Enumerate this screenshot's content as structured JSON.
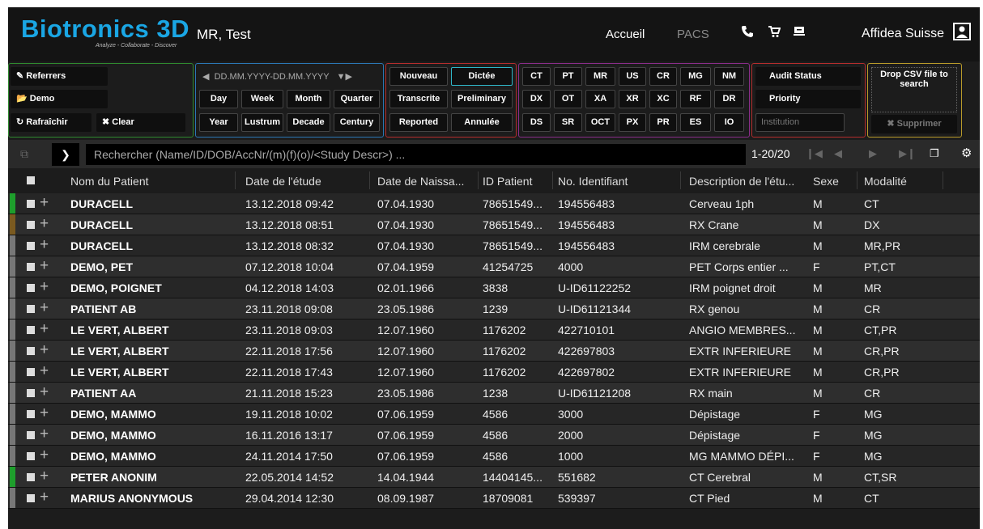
{
  "header": {
    "logo": "Biotronics 3D",
    "tagline": "Analyze - Collaborate - Discover",
    "user_name": "MR, Test",
    "nav_accueil": "Accueil",
    "nav_pacs": "PACS",
    "institution": "Affidea Suisse"
  },
  "filters": {
    "referrers": "Referrers",
    "demo": "Demo",
    "refresh": "Rafraîchir",
    "clear": "Clear",
    "date_placeholder": "DD.MM.YYYY-DD.MM.YYYY",
    "periods_row1": [
      "Day",
      "Week",
      "Month",
      "Quarter"
    ],
    "periods_row2": [
      "Year",
      "Lustrum",
      "Decade",
      "Century"
    ],
    "status": {
      "nouveau": "Nouveau",
      "dictee": "Dictée",
      "transcrite": "Transcrite",
      "preliminary": "Preliminary",
      "reported": "Reported",
      "annulee": "Annulée"
    },
    "modalities_row1": [
      "CT",
      "PT",
      "MR",
      "US",
      "CR",
      "MG",
      "NM"
    ],
    "modalities_row2": [
      "DX",
      "OT",
      "XA",
      "XR",
      "XC",
      "RF",
      "DR"
    ],
    "modalities_row3": [
      "DS",
      "SR",
      "OCT",
      "PX",
      "PR",
      "ES",
      "IO"
    ],
    "audit_status": "Audit Status",
    "priority": "Priority",
    "institution_placeholder": "Institution",
    "drop_csv": "Drop CSV file to search",
    "supprimer": "Supprimer"
  },
  "search": {
    "placeholder": "Rechercher (Name/ID/DOB/AccNr/(m)(f)(o)/<Study Descr>) ...",
    "count": "1-20/20"
  },
  "columns": {
    "name": "Nom du Patient",
    "study_date": "Date de l'étude",
    "dob": "Date de Naissa...",
    "patient_id": "ID Patient",
    "accession": "No. Identifiant",
    "description": "Description de l'étu...",
    "sex": "Sexe",
    "modality": "Modalité"
  },
  "rows": [
    {
      "status_color": "#1e9e2c",
      "name": "DURACELL",
      "study_date": "13.12.2018 09:42",
      "dob": "07.04.1930",
      "pid": "78651549...",
      "acc": "194556483",
      "desc": "Cerveau 1ph",
      "sex": "M",
      "mod": "CT"
    },
    {
      "status_color": "#7a5a20",
      "name": "DURACELL",
      "study_date": "13.12.2018 08:51",
      "dob": "07.04.1930",
      "pid": "78651549...",
      "acc": "194556483",
      "desc": "RX Crane",
      "sex": "M",
      "mod": "DX"
    },
    {
      "status_color": "#777777",
      "name": "DURACELL",
      "study_date": "13.12.2018 08:32",
      "dob": "07.04.1930",
      "pid": "78651549...",
      "acc": "194556483",
      "desc": "IRM cerebrale",
      "sex": "M",
      "mod": "MR,PR"
    },
    {
      "status_color": "#777777",
      "name": "DEMO, PET",
      "study_date": "07.12.2018 10:04",
      "dob": "07.04.1959",
      "pid": "41254725",
      "acc": "4000",
      "desc": "PET Corps entier ...",
      "sex": "F",
      "mod": "PT,CT"
    },
    {
      "status_color": "#777777",
      "name": "DEMO, POIGNET",
      "study_date": "04.12.2018 14:03",
      "dob": "02.01.1966",
      "pid": "3838",
      "acc": "U-ID61122252",
      "desc": "IRM poignet droit",
      "sex": "M",
      "mod": "MR"
    },
    {
      "status_color": "#777777",
      "name": "PATIENT AB",
      "study_date": "23.11.2018 09:08",
      "dob": "23.05.1986",
      "pid": "1239",
      "acc": "U-ID61121344",
      "desc": "RX genou",
      "sex": "M",
      "mod": "CR"
    },
    {
      "status_color": "#777777",
      "name": "LE VERT, ALBERT",
      "study_date": "23.11.2018 09:03",
      "dob": "12.07.1960",
      "pid": "1176202",
      "acc": "422710101",
      "desc": "ANGIO MEMBRES...",
      "sex": "M",
      "mod": "CT,PR"
    },
    {
      "status_color": "#777777",
      "name": "LE VERT, ALBERT",
      "study_date": "22.11.2018 17:56",
      "dob": "12.07.1960",
      "pid": "1176202",
      "acc": "422697803",
      "desc": "EXTR INFERIEURE",
      "sex": "M",
      "mod": "CR,PR"
    },
    {
      "status_color": "#777777",
      "name": "LE VERT, ALBERT",
      "study_date": "22.11.2018 17:43",
      "dob": "12.07.1960",
      "pid": "1176202",
      "acc": "422697802",
      "desc": "EXTR INFERIEURE",
      "sex": "M",
      "mod": "CR,PR"
    },
    {
      "status_color": "#777777",
      "name": "PATIENT AA",
      "study_date": "21.11.2018 15:23",
      "dob": "23.05.1986",
      "pid": "1238",
      "acc": "U-ID61121208",
      "desc": "RX main",
      "sex": "M",
      "mod": "CR"
    },
    {
      "status_color": "#777777",
      "name": "DEMO, MAMMO",
      "study_date": "19.11.2018 10:02",
      "dob": "07.06.1959",
      "pid": "4586",
      "acc": "3000",
      "desc": "Dépistage",
      "sex": "F",
      "mod": "MG"
    },
    {
      "status_color": "#777777",
      "name": "DEMO, MAMMO",
      "study_date": "16.11.2016 13:17",
      "dob": "07.06.1959",
      "pid": "4586",
      "acc": "2000",
      "desc": "Dépistage",
      "sex": "F",
      "mod": "MG"
    },
    {
      "status_color": "#777777",
      "name": "DEMO, MAMMO",
      "study_date": "24.11.2014 17:50",
      "dob": "07.06.1959",
      "pid": "4586",
      "acc": "1000",
      "desc": "MG MAMMO DÉPI...",
      "sex": "F",
      "mod": "MG"
    },
    {
      "status_color": "#1e9e2c",
      "name": "PETER ANONIM",
      "study_date": "22.05.2014 14:52",
      "dob": "14.04.1944",
      "pid": "14404145...",
      "acc": "551682",
      "desc": "CT Cerebral",
      "sex": "M",
      "mod": "CT,SR"
    },
    {
      "status_color": "#777777",
      "name": "MARIUS ANONYMOUS",
      "study_date": "29.04.2014 12:30",
      "dob": "08.09.1987",
      "pid": "18709081",
      "acc": "539397",
      "desc": "CT Pied",
      "sex": "M",
      "mod": "CT"
    }
  ]
}
